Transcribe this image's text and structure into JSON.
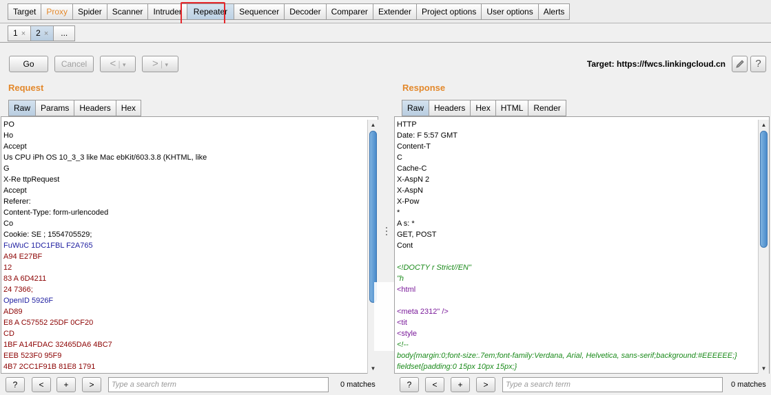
{
  "main_tabs": [
    {
      "label": "Target"
    },
    {
      "label": "Proxy"
    },
    {
      "label": "Spider"
    },
    {
      "label": "Scanner"
    },
    {
      "label": "Intruder"
    },
    {
      "label": "Repeater"
    },
    {
      "label": "Sequencer"
    },
    {
      "label": "Decoder"
    },
    {
      "label": "Comparer"
    },
    {
      "label": "Extender"
    },
    {
      "label": "Project options"
    },
    {
      "label": "User options"
    },
    {
      "label": "Alerts"
    }
  ],
  "repeater_tabs": [
    {
      "label": "1",
      "close": "×"
    },
    {
      "label": "2",
      "close": "×"
    },
    {
      "label": "..."
    }
  ],
  "toolbar": {
    "go_label": "Go",
    "cancel_label": "Cancel",
    "back_label": "<",
    "forward_label": ">",
    "dropdown_glyph": "▾",
    "target_label": "Target: https://fwcs.linkingcloud.cn",
    "edit_icon": "pencil-icon",
    "help_label": "?"
  },
  "request": {
    "title": "Request",
    "tabs": [
      "Raw",
      "Params",
      "Headers",
      "Hex"
    ],
    "lines": [
      {
        "text": "PO",
        "color": "black"
      },
      {
        "text": "Ho",
        "color": "black"
      },
      {
        "text": "Accept",
        "color": "black"
      },
      {
        "text": "Us                          CPU iPh          OS 10_3_3 like Mac                                   ebKit/603.3.8 (KHTML, like",
        "color": "black"
      },
      {
        "text": "G",
        "color": "black"
      },
      {
        "text": "X-Re                   ttpRequest",
        "color": "black"
      },
      {
        "text": "Accept",
        "color": "black"
      },
      {
        "text": "Referer:",
        "color": "black"
      },
      {
        "text": "Content-Type:                          form-urlencoded",
        "color": "black"
      },
      {
        "text": "Co",
        "color": "black"
      },
      {
        "text": "Cookie: SE                                           ;                                        1554705529;",
        "color": "black"
      },
      {
        "text": "FuWuC                                                                                           1DC1FBL  F2A765",
        "color": "blue"
      },
      {
        "text": "A94                                                                                                             E27BF",
        "color": "maroon"
      },
      {
        "text": "                                                                                                                     12",
        "color": "maroon"
      },
      {
        "text": "83                                                                                                   A   6D4211",
        "color": "maroon"
      },
      {
        "text": "24                  7366;",
        "color": "maroon"
      },
      {
        "text": "OpenID                                                                                                        5926F",
        "color": "blue"
      },
      {
        "text": "                                                                                                                  AD89",
        "color": "maroon"
      },
      {
        "text": "E8         A     C57552                                                                              25DF    0CF20",
        "color": "maroon"
      },
      {
        "text": "CD",
        "color": "maroon"
      },
      {
        "text": "1BF           A14FDAC                          32465DA6                                             4BC7",
        "color": "maroon"
      },
      {
        "text": "EEB          523F0                                                                                        95F9",
        "color": "maroon"
      },
      {
        "text": "4B7                                                                                          2CC1F91B  81E8  1791",
        "color": "maroon"
      }
    ],
    "search_placeholder": "Type a search term",
    "matches": "0 matches"
  },
  "response": {
    "title": "Response",
    "tabs": [
      "Raw",
      "Headers",
      "Hex",
      "HTML",
      "Render"
    ],
    "lines": [
      {
        "text": "HTTP",
        "color": "black"
      },
      {
        "text": "Date: F                         5:57 GMT",
        "color": "black"
      },
      {
        "text": "Content-T",
        "color": "black"
      },
      {
        "text": "C",
        "color": "black"
      },
      {
        "text": "Cache-C",
        "color": "black"
      },
      {
        "text": "X-AspN                           2",
        "color": "black"
      },
      {
        "text": "X-AspN",
        "color": "black"
      },
      {
        "text": "X-Pow",
        "color": "black"
      },
      {
        "text": "                                            *",
        "color": "black"
      },
      {
        "text": "A                                          s: *",
        "color": "black"
      },
      {
        "text": "                                        GET, POST",
        "color": "black"
      },
      {
        "text": "Cont",
        "color": "black"
      },
      {
        "text": "",
        "color": "black"
      },
      {
        "text": "<!DOCTY                                                         r Strict//EN\"",
        "color": "green"
      },
      {
        "text": "\"h",
        "color": "green"
      },
      {
        "text": "<html",
        "color": "purple"
      },
      {
        "text": "",
        "color": "black"
      },
      {
        "text": "<meta                                                                       2312\" />",
        "color": "purple"
      },
      {
        "text": "<tit",
        "color": "purple"
      },
      {
        "text": "<style",
        "color": "purple"
      },
      {
        "text": "<!--",
        "color": "green"
      },
      {
        "text": "body{margin:0;font-size:.7em;font-family:Verdana, Arial, Helvetica, sans-serif;background:#EEEEEE;}",
        "color": "green"
      },
      {
        "text": "fieldset{padding:0 15px 10px 15px;}",
        "color": "green"
      }
    ],
    "search_placeholder": "Type a search term",
    "matches": "0 matches"
  },
  "search_buttons": {
    "help": "?",
    "prev": "<",
    "next_plus": "+",
    "next": ">"
  },
  "colors": {
    "accent_orange": "#e3882b",
    "highlight_red": "#e5262b",
    "selected_tab_blue": "#c4d6e8"
  }
}
